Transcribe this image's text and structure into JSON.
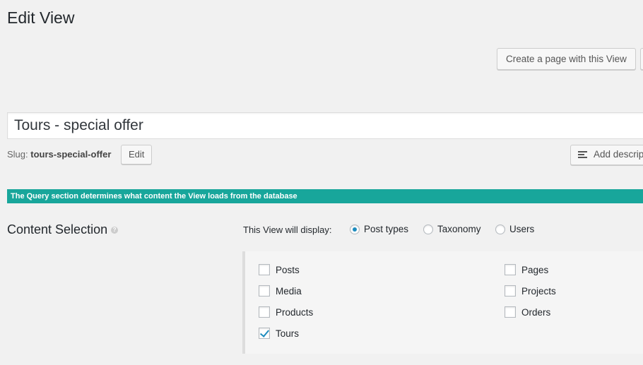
{
  "page": {
    "title": "Edit View"
  },
  "actions": {
    "create_page": "Create a page with this View"
  },
  "title_field": {
    "value": "Tours - special offer"
  },
  "slug": {
    "label": "Slug:",
    "value": "tours-special-offer",
    "edit_label": "Edit"
  },
  "description": {
    "add_label": "Add description"
  },
  "query_banner": {
    "text": "The Query section determines what content the View loads from the database",
    "color": "#18a69b"
  },
  "content_selection": {
    "title": "Content Selection",
    "display_label": "This View will display:",
    "options": [
      {
        "label": "Post types",
        "checked": true
      },
      {
        "label": "Taxonomy",
        "checked": false
      },
      {
        "label": "Users",
        "checked": false
      }
    ],
    "post_types": [
      {
        "label": "Posts",
        "checked": false
      },
      {
        "label": "Media",
        "checked": false
      },
      {
        "label": "Products",
        "checked": false
      },
      {
        "label": "Tours",
        "checked": true
      },
      {
        "label": "Pages",
        "checked": false
      },
      {
        "label": "Projects",
        "checked": false
      },
      {
        "label": "Orders",
        "checked": false
      }
    ]
  },
  "colors": {
    "accent": "#1e8cbe",
    "banner": "#18a69b"
  }
}
